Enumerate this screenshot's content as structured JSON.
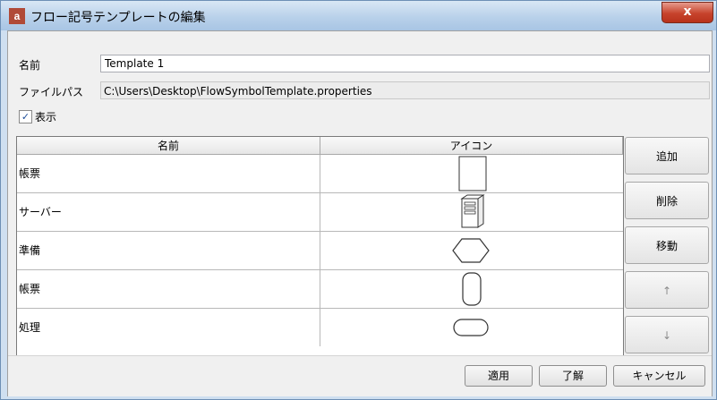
{
  "window": {
    "app_icon_text": "a",
    "title": "フロー記号テンプレートの編集",
    "close_symbol": "x"
  },
  "form": {
    "name_label": "名前",
    "name_value": "Template 1",
    "file_label": "ファイルパス",
    "file_path": "C:\\Users\\Desktop\\FlowSymbolTemplate.properties",
    "show_label": "表示",
    "show_checked": true,
    "check_mark": "✓"
  },
  "table": {
    "columns": [
      "名前",
      "アイコン"
    ],
    "rows": [
      {
        "name": "帳票",
        "icon": "document-rect-icon"
      },
      {
        "name": "サーバー",
        "icon": "server-icon"
      },
      {
        "name": "準備",
        "icon": "hexagon-icon"
      },
      {
        "name": "帳票",
        "icon": "vertical-capsule-icon"
      },
      {
        "name": "処理",
        "icon": "terminator-icon"
      }
    ]
  },
  "side_buttons": {
    "add": "追加",
    "delete": "削除",
    "move": "移動",
    "up": "↑",
    "down": "↓"
  },
  "footer": {
    "apply": "適用",
    "ok": "了解",
    "cancel": "キャンセル"
  }
}
